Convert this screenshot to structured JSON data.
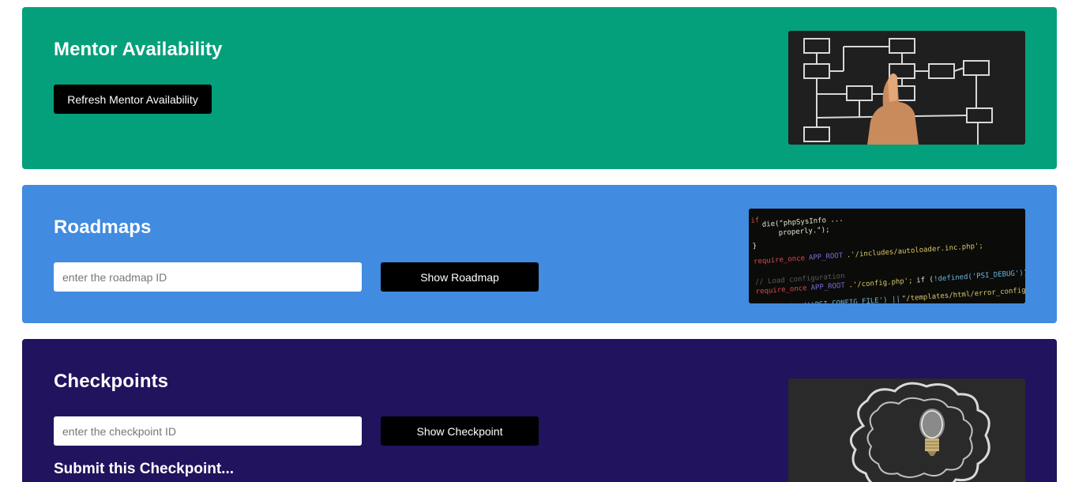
{
  "mentor": {
    "title": "Mentor Availability",
    "refresh_label": "Refresh Mentor Availability",
    "image_icon": "flowchart-hand-photo"
  },
  "roadmaps": {
    "title": "Roadmaps",
    "input_placeholder": "enter the roadmap ID",
    "show_label": "Show Roadmap",
    "image_icon": "code-screen-photo"
  },
  "checkpoints": {
    "title": "Checkpoints",
    "input_placeholder": "enter the checkpoint ID",
    "show_label": "Show Checkpoint",
    "submit_heading": "Submit this Checkpoint...",
    "image_icon": "lightbulb-chalk-photo"
  },
  "colors": {
    "mentor_panel": "#04a07b",
    "roadmaps_panel": "#418be0",
    "checkpoints_panel": "#21135e",
    "button": "#000000"
  }
}
